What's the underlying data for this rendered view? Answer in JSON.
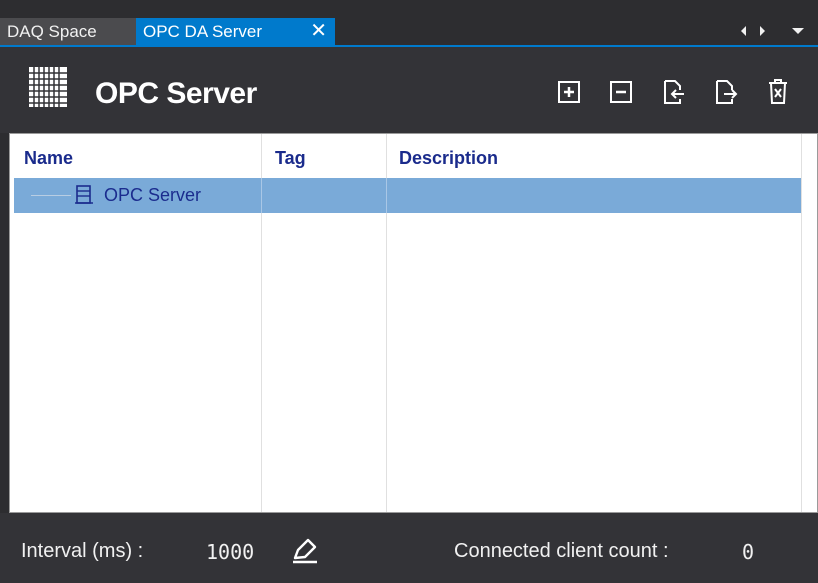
{
  "tabs": [
    {
      "label": "DAQ Space",
      "active": false
    },
    {
      "label": "OPC DA Server",
      "active": true,
      "close_icon": "close-icon"
    }
  ],
  "tab_nav": [
    "scroll-left-icon",
    "scroll-right-icon",
    "tab-menu-icon"
  ],
  "header": {
    "icon": "opc-grid-icon",
    "title": "OPC Server",
    "toolbar": [
      "expand-all-icon",
      "collapse-all-icon",
      "import-icon",
      "export-icon",
      "delete-icon"
    ]
  },
  "grid": {
    "columns": [
      "Name",
      "Tag",
      "Description"
    ],
    "rows": [
      {
        "name": "OPC Server",
        "icon": "server-icon",
        "tag": "",
        "description": "",
        "selected": true
      }
    ]
  },
  "status": {
    "interval_label": "Interval (ms) :",
    "interval_value": "1000",
    "edit_icon": "edit-icon",
    "client_label": "Connected client count :",
    "client_value": "0"
  },
  "colors": {
    "accent": "#007acc",
    "selection": "#7aaad8",
    "header_text": "#1a2b8c",
    "background": "#333337"
  }
}
